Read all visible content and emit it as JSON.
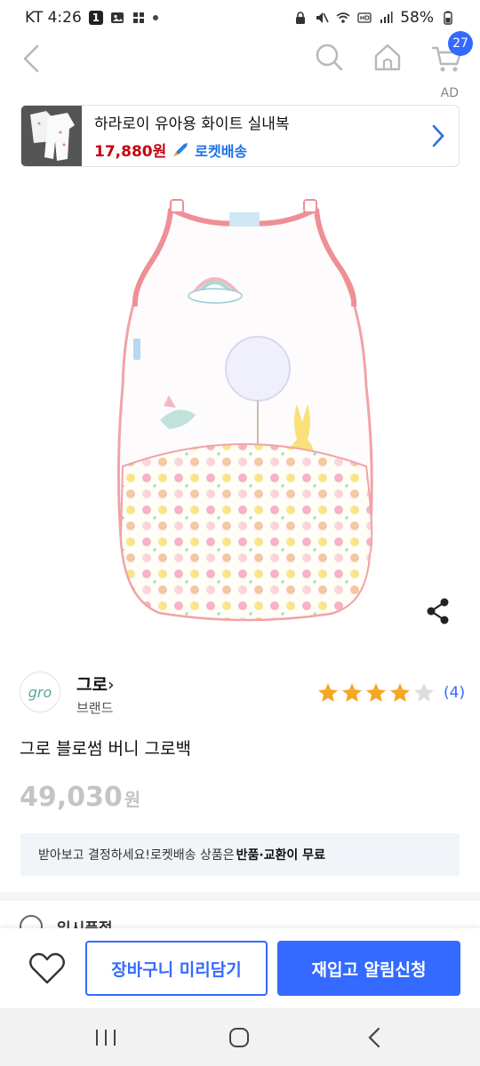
{
  "status_bar": {
    "carrier_time": "KT 4:26",
    "notification_badge": "1",
    "battery": "58%"
  },
  "header": {
    "cart_count": "27"
  },
  "ad": {
    "label": "AD",
    "title": "하라로이 유아용 화이트 실내복",
    "price": "17,880원",
    "delivery": "로켓배송"
  },
  "brand": {
    "logo_text": "gro",
    "name": "그로",
    "sub": "브랜드"
  },
  "rating": {
    "stars": 4,
    "max": 5,
    "count": "(4)"
  },
  "product": {
    "title": "그로 블로썸 버니 그로백",
    "price": "49,030",
    "currency": "원"
  },
  "notice": {
    "text": "받아보고 결정하세요!로켓배송 상품은",
    "strong": "반품·교환이 무료"
  },
  "soldout": {
    "label": "일시품절"
  },
  "actions": {
    "cart_label": "장바구니 미리담기",
    "restock_label": "재입고 알림신청"
  },
  "colors": {
    "accent": "#346aff",
    "ad_price": "#c5000e",
    "star": "#f5a623"
  }
}
